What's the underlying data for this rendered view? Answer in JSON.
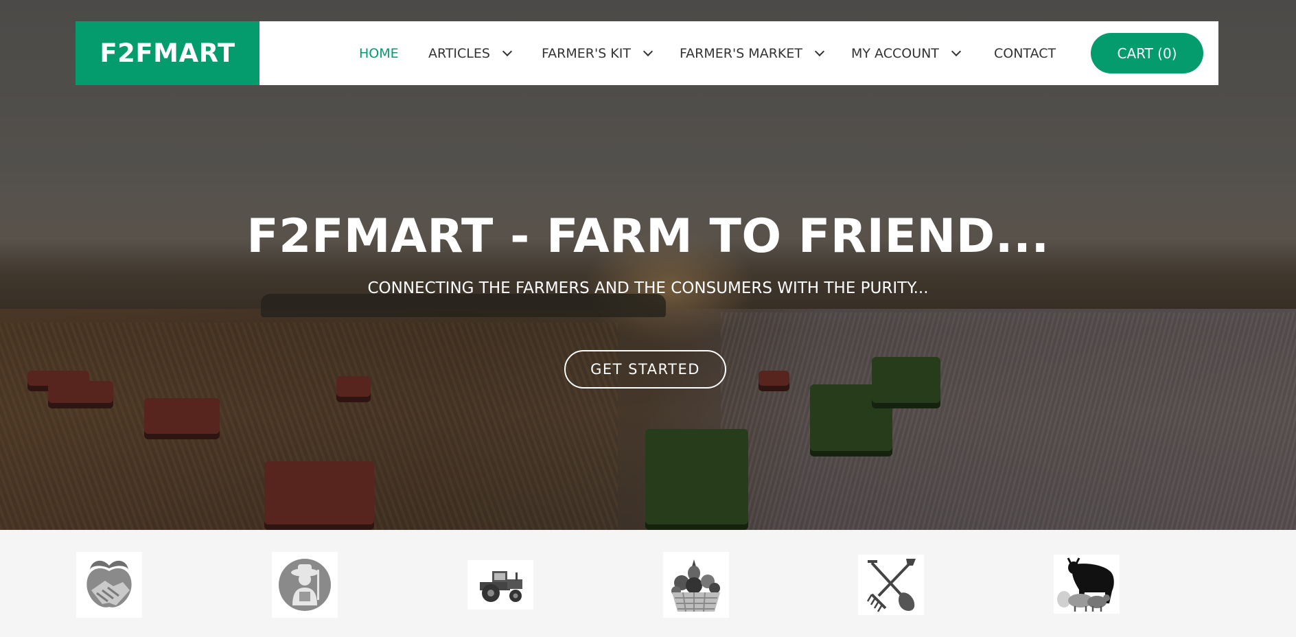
{
  "brand": {
    "name": "F2FMART",
    "accent_color": "#049b6d"
  },
  "nav": {
    "items": [
      {
        "label": "HOME",
        "active": true,
        "dropdown": false
      },
      {
        "label": "ARTICLES",
        "active": false,
        "dropdown": true
      },
      {
        "label": "FARMER'S KIT",
        "active": false,
        "dropdown": true
      },
      {
        "label": "FARMER'S MARKET",
        "active": false,
        "dropdown": true
      },
      {
        "label": "MY ACCOUNT",
        "active": false,
        "dropdown": true
      },
      {
        "label": "CONTACT",
        "active": false,
        "dropdown": false
      }
    ],
    "cart_label": "CART (0)"
  },
  "hero": {
    "title": "F2FMART - FARM TO FRIEND...",
    "subtitle": "CONNECTING THE FARMERS AND THE CONSUMERS WITH THE PURITY...",
    "cta_label": "GET STARTED"
  },
  "categories": [
    {
      "icon": "apple-handshake-icon"
    },
    {
      "icon": "farmer-icon"
    },
    {
      "icon": "tractor-icon"
    },
    {
      "icon": "fruit-basket-icon"
    },
    {
      "icon": "shovel-rake-icon"
    },
    {
      "icon": "livestock-icon"
    }
  ]
}
